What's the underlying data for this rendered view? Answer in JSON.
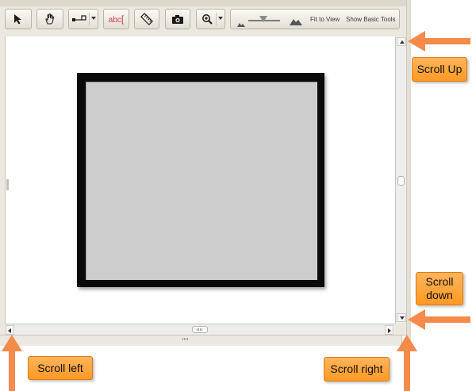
{
  "toolbar": {
    "tools": [
      {
        "icon": "arrow-pointer-icon"
      },
      {
        "icon": "hand-icon"
      },
      {
        "icon": "line-measure-icon"
      },
      {
        "icon": "text-annotation-icon",
        "label": "abc"
      },
      {
        "icon": "ruler-icon"
      },
      {
        "icon": "camera-icon"
      },
      {
        "icon": "zoom-icon"
      }
    ],
    "fit_to_view": "Fit to View",
    "show_basic_tools": "Show Basic Tools"
  },
  "annotations": {
    "scroll_up": "Scroll Up",
    "scroll_down": "Scroll down",
    "scroll_left": "Scroll left",
    "scroll_right": "Scroll right",
    "accent_color": "#ff9a24",
    "arrow_color": "#f58a4a"
  }
}
